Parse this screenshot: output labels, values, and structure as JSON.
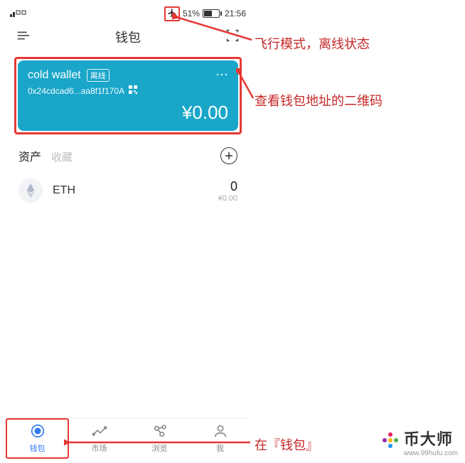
{
  "status_bar": {
    "battery_percent": "51%",
    "time": "21:56"
  },
  "nav": {
    "title": "钱包"
  },
  "wallet_card": {
    "name": "cold wallet",
    "badge": "离线",
    "address": "0x24cdcad6...aa8f1f170A",
    "more": "⋯",
    "balance": "¥0.00"
  },
  "assets_row": {
    "tab_active": "资产",
    "tab_inactive": "收藏"
  },
  "assets": [
    {
      "symbol": "ETH",
      "amount": "0",
      "fiat": "¥0.00"
    }
  ],
  "tabbar": {
    "items": [
      {
        "label": "钱包"
      },
      {
        "label": "市场"
      },
      {
        "label": "浏览"
      },
      {
        "label": "我"
      }
    ]
  },
  "annotations": {
    "a1": "飞行模式，离线状态",
    "a2": "查看钱包地址的二维码",
    "a3": "在『钱包』"
  },
  "watermark": {
    "text1": "币大师",
    "text2": "www.99hufu.com"
  }
}
